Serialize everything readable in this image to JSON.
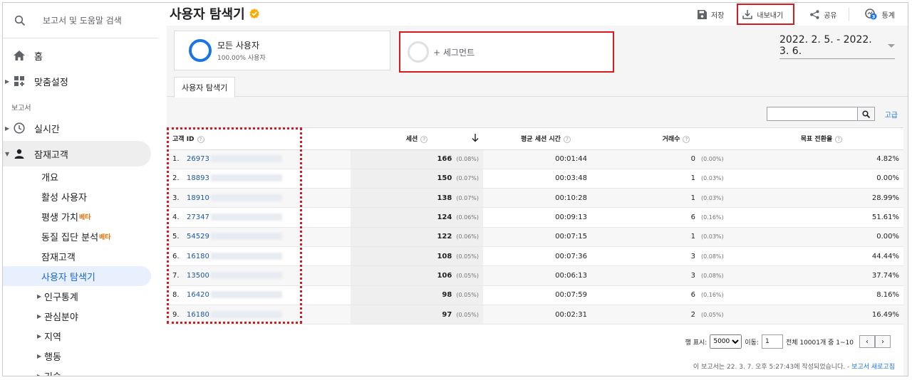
{
  "sidebar": {
    "search_text": "보고서 및 도움말 검색",
    "home": "홈",
    "customize": "맞춤설정",
    "section_reports": "보고서",
    "realtime": "실시간",
    "audience": "잠재고객",
    "sub_items": [
      {
        "label": "개요",
        "sup": ""
      },
      {
        "label": "활성 사용자",
        "sup": ""
      },
      {
        "label": "평생 가치",
        "sup": "베타"
      },
      {
        "label": "동질 집단 분석",
        "sup": "베타"
      },
      {
        "label": "잠재고객",
        "sup": ""
      },
      {
        "label": "사용자 탐색기",
        "sup": ""
      }
    ],
    "deep_items": [
      "인구통계",
      "관심분야",
      "지역",
      "행동",
      "기술"
    ]
  },
  "header": {
    "title": "사용자 탐색기",
    "save": "저장",
    "export": "내보내기",
    "share": "공유",
    "insights": "통계",
    "insights_count": "3"
  },
  "segment": {
    "name": "모든 사용자",
    "pct": "100.00% 사용자",
    "add": "+ 세그먼트"
  },
  "date_range": "2022. 2. 5. - 2022. 3. 6.",
  "tab": "사용자 탐색기",
  "advanced": "고급",
  "table": {
    "headers": {
      "client_id": "고객 ID",
      "sessions": "세션",
      "avg_duration": "평균 세션 시간",
      "transactions": "거래수",
      "goal_rate": "목표 전환율"
    },
    "rows": [
      {
        "n": "1.",
        "id": "26973",
        "sessions": "166",
        "spct": "(0.08%)",
        "dur": "00:01:44",
        "tx": "0",
        "txpct": "(0.00%)",
        "goal": "4.82%"
      },
      {
        "n": "2.",
        "id": "18893",
        "sessions": "150",
        "spct": "(0.07%)",
        "dur": "00:03:48",
        "tx": "1",
        "txpct": "(0.03%)",
        "goal": "0.00%"
      },
      {
        "n": "3.",
        "id": "18910",
        "sessions": "138",
        "spct": "(0.07%)",
        "dur": "00:10:28",
        "tx": "1",
        "txpct": "(0.03%)",
        "goal": "28.99%"
      },
      {
        "n": "4.",
        "id": "27347",
        "sessions": "124",
        "spct": "(0.06%)",
        "dur": "00:09:13",
        "tx": "6",
        "txpct": "(0.16%)",
        "goal": "51.61%"
      },
      {
        "n": "5.",
        "id": "54529",
        "sessions": "122",
        "spct": "(0.06%)",
        "dur": "00:07:15",
        "tx": "1",
        "txpct": "(0.03%)",
        "goal": "0.00%"
      },
      {
        "n": "6.",
        "id": "16180",
        "sessions": "108",
        "spct": "(0.05%)",
        "dur": "00:07:36",
        "tx": "3",
        "txpct": "(0.08%)",
        "goal": "44.44%"
      },
      {
        "n": "7.",
        "id": "13500",
        "sessions": "106",
        "spct": "(0.05%)",
        "dur": "00:06:13",
        "tx": "3",
        "txpct": "(0.08%)",
        "goal": "37.74%"
      },
      {
        "n": "8.",
        "id": "16420",
        "sessions": "98",
        "spct": "(0.05%)",
        "dur": "00:07:59",
        "tx": "6",
        "txpct": "(0.16%)",
        "goal": "8.16%"
      },
      {
        "n": "9.",
        "id": "16180",
        "sessions": "97",
        "spct": "(0.05%)",
        "dur": "00:02:31",
        "tx": "2",
        "txpct": "(0.05%)",
        "goal": "16.49%"
      }
    ]
  },
  "pager": {
    "show_rows_label": "행 표시:",
    "show_rows_value": "5000",
    "goto_label": "이동:",
    "goto_value": "1",
    "summary": "전체 10001개 중 1~10"
  },
  "footer": {
    "text": "이 보고서는 22. 3. 7. 오후 5:27:43에 작성되었습니다. - ",
    "refresh": "보고서 새로고침"
  },
  "colors": {
    "accent": "#1a73e8",
    "highlight": "#d71920",
    "badge": "#f9ab00"
  }
}
